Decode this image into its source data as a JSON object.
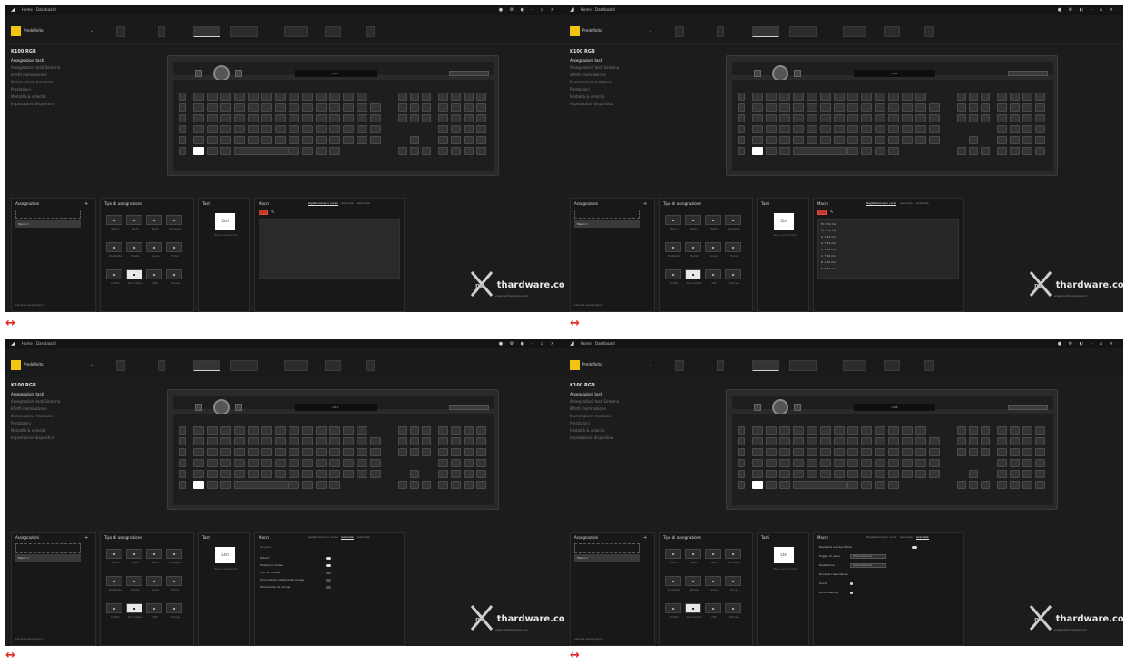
{
  "separator_glyph": "↔",
  "accent_colors": {
    "profile": "#f1c40f",
    "separator": "#e0261e",
    "record": "#c0392b"
  },
  "panels": [
    {
      "titlebar": {
        "nav_home": "Home",
        "nav_dashboard": "Dashboard"
      },
      "profile": {
        "name": "Predefinito"
      },
      "keyboard": {
        "model": "K100 RGB",
        "display_text": "iCUE"
      },
      "sidebar": {
        "title": "K100 RGB",
        "items": [
          "Assegnazioni tasti",
          "Assegnazioni tasti Sorbena",
          "Effetti illuminazione",
          "Illuminazione hardware",
          "Prestazioni",
          "Modalità & velocità",
          "Impostazioni dispositivo"
        ],
        "selected": 0
      },
      "assignments": {
        "title": "Assegnazioni",
        "item": "Macro 1",
        "footer": "Libreria assegnazioni"
      },
      "types": {
        "title": "Tipo di assegnazione",
        "buttons": [
          "Macro",
          "Testo",
          "Tasto",
          "Rimappa",
          "Disabilita",
          "Media",
          "Avvia",
          "Timer",
          "Profilo",
          "Scorciatoia",
          "DPI",
          "Mouse"
        ],
        "selected": 9
      },
      "key": {
        "title": "Tasti",
        "card": "Ctrl",
        "caption": "Tasto selezionato"
      },
      "macro": {
        "title": "Macro",
        "tabs": [
          "Registrazione in corso",
          "Generale",
          "Avanzate"
        ],
        "active_tab": 0,
        "mode": "empty"
      }
    },
    {
      "titlebar": {
        "nav_home": "Home",
        "nav_dashboard": "Dashboard"
      },
      "profile": {
        "name": "Predefinito"
      },
      "keyboard": {
        "model": "K100 RGB",
        "display_text": "iCUE"
      },
      "sidebar": {
        "title": "K100 RGB",
        "items": [
          "Assegnazioni tasti",
          "Assegnazioni tasti Sorbena",
          "Effetti illuminazione",
          "Illuminazione hardware",
          "Prestazioni",
          "Modalità & velocità",
          "Impostazioni dispositivo"
        ],
        "selected": 0
      },
      "assignments": {
        "title": "Assegnazioni",
        "item": "Macro 1",
        "footer": "Libreria assegnazioni"
      },
      "types": {
        "title": "Tipo di assegnazione",
        "buttons": [
          "Macro",
          "Testo",
          "Tasto",
          "Rimappa",
          "Disabilita",
          "Media",
          "Avvia",
          "Timer",
          "Profilo",
          "Scorciatoia",
          "DPI",
          "Mouse"
        ],
        "selected": 9
      },
      "key": {
        "title": "Tasti",
        "card": "Ctrl",
        "caption": "Tasto selezionato"
      },
      "macro": {
        "title": "Macro",
        "tabs": [
          "Registrazione in corso",
          "Generale",
          "Avanzate"
        ],
        "active_tab": 0,
        "mode": "sequence",
        "sequence": [
          "M ↓ 50 ms",
          "M ↑ 50 ms",
          "A ↓ 50 ms",
          "A ↑ 50 ms",
          "C ↓ 50 ms",
          "C ↑ 50 ms",
          "R ↓ 50 ms",
          "R ↑ 50 ms"
        ]
      }
    },
    {
      "titlebar": {
        "nav_home": "Home",
        "nav_dashboard": "Dashboard"
      },
      "profile": {
        "name": "Predefinito"
      },
      "keyboard": {
        "model": "K100 RGB",
        "display_text": "iCUE"
      },
      "sidebar": {
        "title": "K100 RGB",
        "items": [
          "Assegnazioni tasti",
          "Assegnazioni tasti Sorbena",
          "Effetti illuminazione",
          "Illuminazione hardware",
          "Prestazioni",
          "Modalità & velocità",
          "Impostazioni dispositivo"
        ],
        "selected": 0
      },
      "assignments": {
        "title": "Assegnazioni",
        "item": "Macro 1",
        "footer": "Libreria assegnazioni"
      },
      "types": {
        "title": "Tipo di assegnazione",
        "buttons": [
          "Macro",
          "Testo",
          "Tasto",
          "Rimappa",
          "Disabilita",
          "Media",
          "Avvia",
          "Timer",
          "Profilo",
          "Scorciatoia",
          "DPI",
          "Mouse"
        ],
        "selected": 9
      },
      "key": {
        "title": "Tasti",
        "card": "Ctrl",
        "caption": "Tasto selezionato"
      },
      "macro": {
        "title": "Macro",
        "tabs": [
          "Registrazione in corso",
          "Generale",
          "Avanzate"
        ],
        "active_tab": 1,
        "mode": "general",
        "section": "Registra",
        "options": [
          {
            "label": "Ritardi",
            "on": true
          },
          {
            "label": "Posizione mouse",
            "on": true
          },
          {
            "label": "Clic del mouse",
            "on": false
          },
          {
            "label": "Scorrimento rotellina del mouse",
            "on": false
          },
          {
            "label": "Movimento del mouse",
            "on": false
          }
        ]
      }
    },
    {
      "titlebar": {
        "nav_home": "Home",
        "nav_dashboard": "Dashboard"
      },
      "profile": {
        "name": "Predefinito"
      },
      "keyboard": {
        "model": "K100 RGB",
        "display_text": "iCUE"
      },
      "sidebar": {
        "title": "K100 RGB",
        "items": [
          "Assegnazioni tasti",
          "Assegnazioni tasti Sorbena",
          "Effetti illuminazione",
          "Illuminazione hardware",
          "Prestazioni",
          "Modalità & velocità",
          "Impostazioni dispositivo"
        ],
        "selected": 0
      },
      "assignments": {
        "title": "Assegnazioni",
        "item": "Macro 1",
        "footer": "Libreria assegnazioni"
      },
      "types": {
        "title": "Tipo di assegnazione",
        "buttons": [
          "Macro",
          "Testo",
          "Tasto",
          "Rimappa",
          "Disabilita",
          "Media",
          "Avvia",
          "Timer",
          "Profilo",
          "Scorciatoia",
          "DPI",
          "Mouse"
        ],
        "selected": 9
      },
      "key": {
        "title": "Tasti",
        "card": "Ctrl",
        "caption": "Tasto selezionato"
      },
      "macro": {
        "title": "Macro",
        "tabs": [
          "Registrazione in corso",
          "Generale",
          "Avanzate"
        ],
        "active_tab": 2,
        "mode": "advanced",
        "adv": [
          {
            "label": "Ripristina sovrascrittura",
            "kind": "toggle"
          },
          {
            "label": "Trigger di avvio",
            "kind": "drop",
            "value": "Alla pressione"
          },
          {
            "label": "Ripetizione",
            "kind": "drop",
            "value": "Alla pressione"
          },
          {
            "label": "Durante l'esecuzione",
            "kind": "text"
          },
          {
            "label": "Suoni",
            "kind": "radio"
          },
          {
            "label": "Ricircolazione",
            "kind": "radio"
          }
        ]
      }
    }
  ],
  "watermark": {
    "brand": "thardware.com",
    "prefix": "ne",
    "tagline": "www.nexthardware.com"
  }
}
